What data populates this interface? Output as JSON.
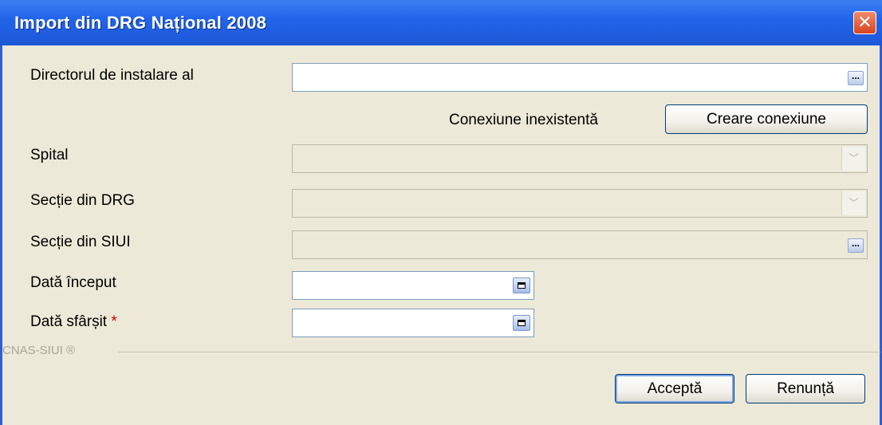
{
  "window": {
    "title": "Import din DRG Național 2008",
    "close_glyph": "✕"
  },
  "fields": {
    "install_dir": {
      "label": "Directorul de instalare al",
      "value": ""
    },
    "connection_status": "Conexiune inexistentă",
    "create_connection_label": "Creare conexiune",
    "hospital": {
      "label": "Spital",
      "value": ""
    },
    "drg_section": {
      "label": "Secție din DRG",
      "value": ""
    },
    "siui_section": {
      "label": "Secție din SIUI",
      "value": ""
    },
    "start_date": {
      "label": "Dată început",
      "value": ""
    },
    "end_date": {
      "label": "Dată sfârșit",
      "required_mark": "*",
      "value": ""
    }
  },
  "footer": {
    "brand": "CNAS-SIUI ®"
  },
  "buttons": {
    "accept": "Acceptă",
    "cancel": "Renunță"
  },
  "icons": {
    "ellipsis": "...",
    "dropdown": "﹀"
  },
  "colors": {
    "titlebar": "#2265ea",
    "window_bg": "#ece9d8",
    "required": "#cc0000",
    "close": "#d8441f"
  }
}
